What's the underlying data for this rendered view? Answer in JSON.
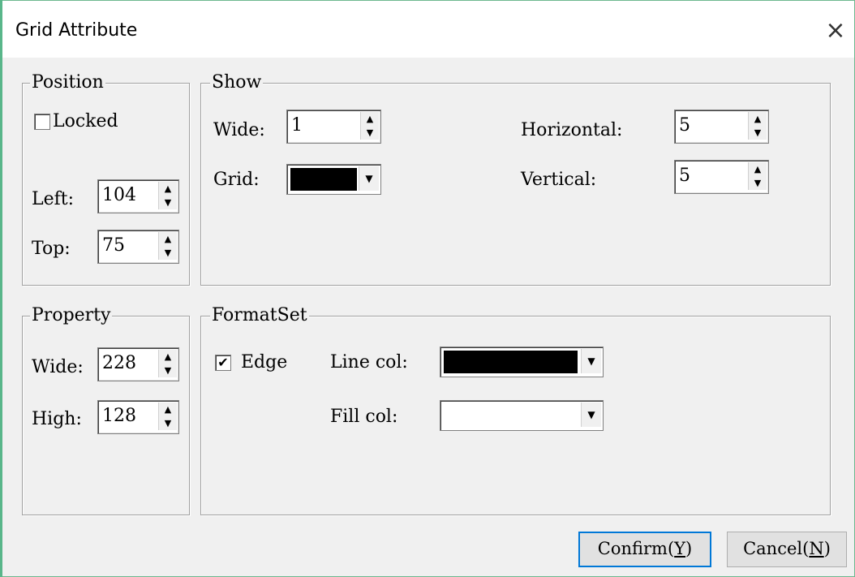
{
  "window": {
    "title": "Grid Attribute",
    "close_glyph": "×"
  },
  "position": {
    "legend": "Position",
    "locked_label": "Locked",
    "locked_checked": false,
    "left_label": "Left:",
    "left_value": "104",
    "top_label": "Top:",
    "top_value": "75"
  },
  "show": {
    "legend": "Show",
    "wide_label": "Wide:",
    "wide_value": "1",
    "grid_label": "Grid:",
    "grid_color": "#000000",
    "horizontal_label": "Horizontal:",
    "horizontal_value": "5",
    "vertical_label": "Vertical:",
    "vertical_value": "5"
  },
  "property": {
    "legend": "Property",
    "wide_label": "Wide:",
    "wide_value": "228",
    "high_label": "High:",
    "high_value": "128"
  },
  "formatset": {
    "legend": "FormatSet",
    "edge_label": "Edge",
    "edge_checked": true,
    "linecol_label": "Line col:",
    "linecol_color": "#000000",
    "fillcol_label": "Fill col:",
    "fillcol_color": "#ffffff"
  },
  "buttons": {
    "confirm_text": "Confirm(",
    "confirm_key": "Y",
    "confirm_end": ")",
    "cancel_text": "Cancel(",
    "cancel_key": "N",
    "cancel_end": ")"
  },
  "icons": {
    "spin_up": "▲",
    "spin_down": "▼",
    "dropdown": "▼",
    "check": "✔"
  }
}
